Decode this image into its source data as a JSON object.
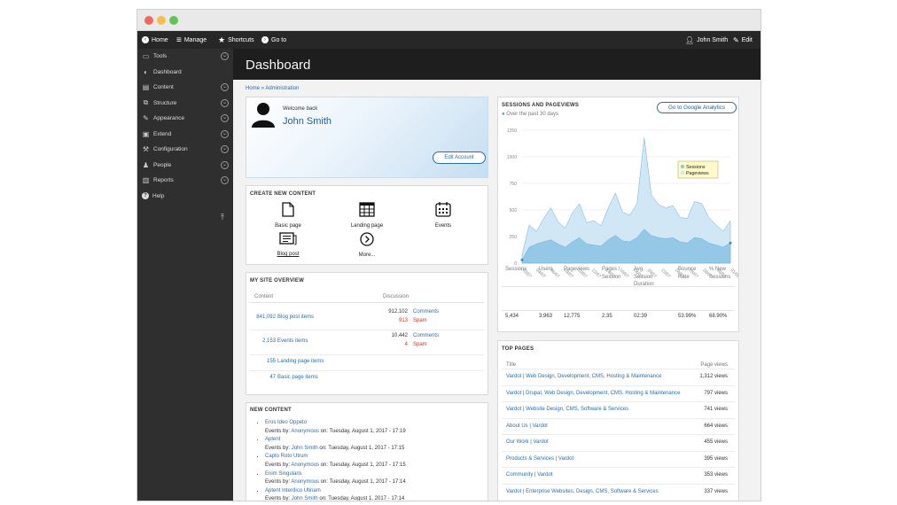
{
  "topbar": {
    "home": "Home",
    "manage": "Manage",
    "shortcuts": "Shortcuts",
    "goto": "Go to",
    "user": "John Smith",
    "edit": "Edit"
  },
  "sidebar": {
    "items": [
      {
        "label": "Tools",
        "icon": "tools-icon",
        "chevron": true
      },
      {
        "label": "Dashboard",
        "icon": "dashboard-icon",
        "chevron": false
      },
      {
        "label": "Content",
        "icon": "content-icon",
        "chevron": true
      },
      {
        "label": "Structure",
        "icon": "structure-icon",
        "chevron": true
      },
      {
        "label": "Appearance",
        "icon": "appearance-icon",
        "chevron": true
      },
      {
        "label": "Extend",
        "icon": "extend-icon",
        "chevron": true
      },
      {
        "label": "Configuration",
        "icon": "configuration-icon",
        "chevron": true
      },
      {
        "label": "People",
        "icon": "people-icon",
        "chevron": true
      },
      {
        "label": "Reports",
        "icon": "reports-icon",
        "chevron": true
      },
      {
        "label": "Help",
        "icon": "help-icon",
        "chevron": false
      }
    ]
  },
  "page": {
    "title": "Dashboard",
    "breadcrumb_home": "Home",
    "breadcrumb_sep": " » ",
    "breadcrumb_admin": "Administration"
  },
  "welcome": {
    "greeting": "Welcome back",
    "name": "John Smith",
    "edit_button": "Edit Account"
  },
  "create": {
    "title": "CREATE NEW CONTENT",
    "items": [
      "Basic page",
      "Landing page",
      "Events",
      "Blog post",
      "More..."
    ]
  },
  "overview": {
    "title": "MY SITE OVERVIEW",
    "col_content": "Content",
    "col_discussion": "Discussion",
    "rows": [
      {
        "count": "841,092",
        "label": "Blog post items",
        "comments": "912,102",
        "comments_label": "Comments",
        "spam": "913",
        "spam_label": "Spam"
      },
      {
        "count": "2,153",
        "label": "Events items",
        "comments": "10,442",
        "comments_label": "Comments",
        "spam": "4",
        "spam_label": "Spam"
      },
      {
        "count": "155",
        "label": "Landing page items"
      },
      {
        "count": "47",
        "label": "Basic page items"
      }
    ]
  },
  "newcontent": {
    "title": "NEW CONTENT",
    "items": [
      {
        "title": "Eros Ideo Oppeto",
        "prefix": "Events by:",
        "author": "Anonymous",
        "date": "on: Tuesday, August 1, 2017 - 17:19"
      },
      {
        "title": "Aptent",
        "prefix": "Events by:",
        "author": "John Smith",
        "date": "on: Tuesday, August 1, 2017 - 17:15"
      },
      {
        "title": "Capto Roto Utrum",
        "prefix": "Events by:",
        "author": "Anonymous",
        "date": "on: Tuesday, August 1, 2017 - 17:15"
      },
      {
        "title": "Enim Singularis",
        "prefix": "Events by:",
        "author": "Anonymous",
        "date": "on: Tuesday, August 1, 2017 - 17:14"
      },
      {
        "title": "Aptent Interdico Utinam",
        "prefix": "Events by:",
        "author": "John Smith",
        "date": "on: Tuesday, August 1, 2017 - 17:14"
      }
    ]
  },
  "analytics": {
    "title": "SESSIONS AND PAGEVIEWS",
    "subtitle": "Over the past 30 days",
    "button": "Go to Google Analytics",
    "stats": [
      {
        "label": "Sessions",
        "value": "5,434"
      },
      {
        "label": "Users",
        "value": "3,963"
      },
      {
        "label": "Pageviews",
        "value": "12,775"
      },
      {
        "label": "Pages / Session",
        "value": "2.35"
      },
      {
        "label": "Avg. Session Duration",
        "value": "02:39"
      },
      {
        "label": "Bounce Rate",
        "value": "53.99%"
      },
      {
        "label": "% New Sessions",
        "value": "68.90%"
      }
    ]
  },
  "toppages": {
    "title": "TOP PAGES",
    "col_title": "Title",
    "col_views": "Page views",
    "rows": [
      {
        "title": "Vardot | Web Design, Development, CMS, Hosting & Maintenance",
        "views": "1,312 views"
      },
      {
        "title": "Vardot | Drupal, Web Design, Development, CMS, Hosting & Maintenance",
        "views": "797 views"
      },
      {
        "title": "Vardot | Website Design, CMS, Software & Services",
        "views": "741 views"
      },
      {
        "title": "About Us | Vardot",
        "views": "664 views"
      },
      {
        "title": "Our Work | Vardot",
        "views": "455 views"
      },
      {
        "title": "Products & Services | Vardot",
        "views": "395 views"
      },
      {
        "title": "Community | Vardot",
        "views": "353 views"
      },
      {
        "title": "Vardot | Enterprise Websites, Design, CMS, Software & Services",
        "views": "337 views"
      }
    ]
  },
  "chart_data": {
    "type": "area",
    "y_ticks": [
      "1250",
      "1000",
      "750",
      "500",
      "250",
      "0"
    ],
    "ylim": [
      0,
      1250
    ],
    "x_ticks": [
      "02/07",
      "04/07",
      "06/07",
      "08/07",
      "10/07",
      "12/07",
      "14/07",
      "16/07",
      "18/07",
      "20/07",
      "22/07",
      "24/07",
      "26/07",
      "28/07",
      "30/07",
      "01/08"
    ],
    "grid": true,
    "legend_position": "top-right",
    "colors": {
      "sessions": "#8ec3e6",
      "pageviews": "#cfe6f5",
      "sessions_line": "#6aaed8"
    },
    "series": [
      {
        "name": "Pageviews",
        "values": [
          80,
          360,
          300,
          420,
          520,
          390,
          330,
          470,
          560,
          380,
          400,
          350,
          520,
          660,
          480,
          450,
          560,
          1180,
          640,
          550,
          520,
          540,
          430,
          420,
          580,
          560,
          430,
          360,
          300,
          400
        ]
      },
      {
        "name": "Sessions",
        "values": [
          30,
          150,
          180,
          200,
          220,
          180,
          150,
          200,
          240,
          180,
          170,
          160,
          220,
          260,
          210,
          200,
          240,
          320,
          260,
          240,
          230,
          240,
          200,
          190,
          240,
          230,
          190,
          170,
          150,
          190
        ]
      }
    ]
  }
}
